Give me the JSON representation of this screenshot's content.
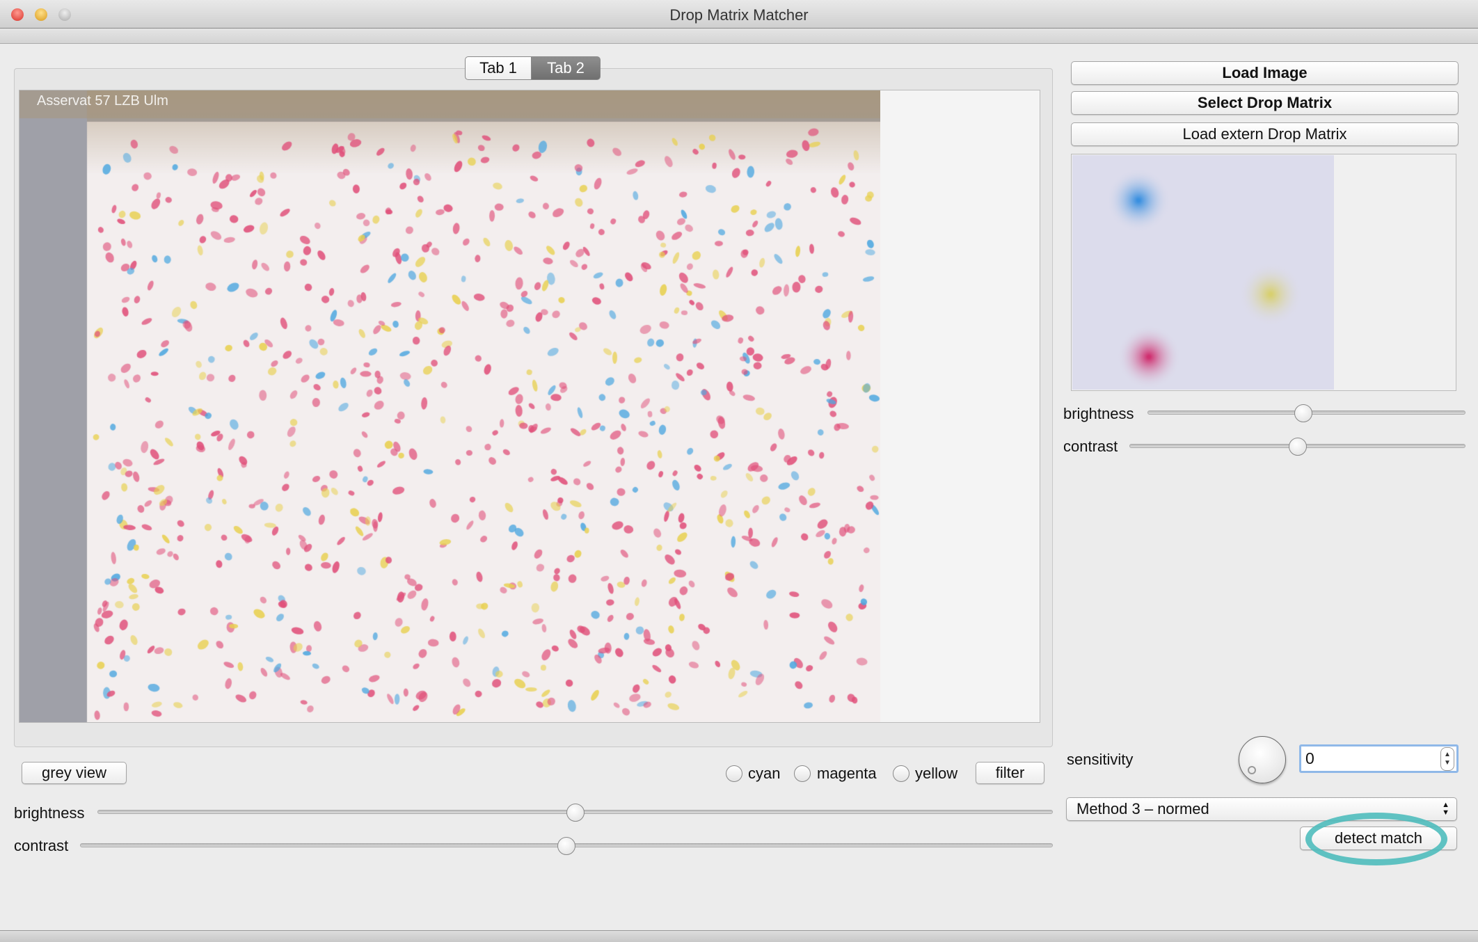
{
  "window": {
    "title": "Drop Matrix Matcher",
    "traffic_lights": {
      "close": "#e8433d",
      "minimize": "#e8a62a",
      "zoom": "#c8c8c8"
    }
  },
  "tabs": [
    {
      "label": "Tab 1",
      "selected": false
    },
    {
      "label": "Tab 2",
      "selected": true
    }
  ],
  "image_view": {
    "caption": "Asservat 57 LZB Ulm"
  },
  "left_controls": {
    "grey_view_label": "grey view",
    "radios": [
      {
        "label": "cyan",
        "checked": false
      },
      {
        "label": "magenta",
        "checked": false
      },
      {
        "label": "yellow",
        "checked": false
      }
    ],
    "filter_label": "filter",
    "brightness": {
      "label": "brightness",
      "value_percent": 50
    },
    "contrast": {
      "label": "contrast",
      "value_percent": 50
    }
  },
  "right_panel": {
    "load_image_label": "Load Image",
    "select_drop_matrix_label": "Select Drop Matrix",
    "load_extern_label": "Load extern Drop Matrix",
    "brightness": {
      "label": "brightness",
      "value_percent": 49
    },
    "contrast": {
      "label": "contrast",
      "value_percent": 50
    },
    "sensitivity": {
      "label": "sensitivity",
      "value": "0"
    },
    "method": {
      "selected": "Method 3 – normed"
    },
    "detect_match_label": "detect match",
    "highlight_color": "#4fbcbc"
  }
}
